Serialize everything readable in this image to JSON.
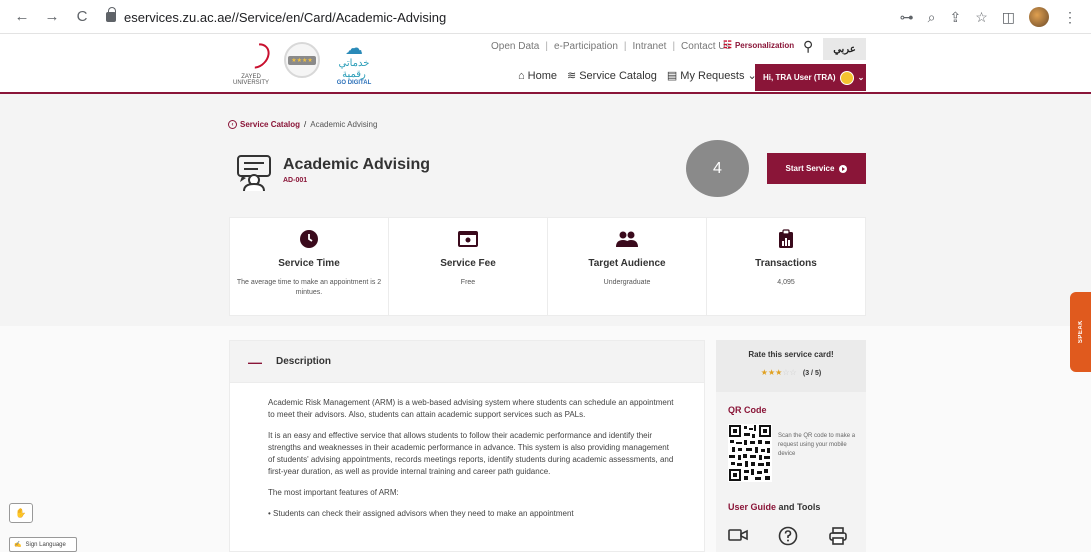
{
  "browser": {
    "nav_back": "←",
    "nav_forward": "→",
    "nav_reload": "C",
    "url": "eservices.zu.ac.ae//Service/en/Card/Academic-Advising"
  },
  "header": {
    "top_links": [
      "Open Data",
      "e-Participation",
      "Intranet",
      "Contact Us"
    ],
    "personalization": "Personalization",
    "arabic": "عربي",
    "nav": [
      {
        "icon": "home-icon",
        "label": "Home"
      },
      {
        "icon": "catalog-icon",
        "label": "Service Catalog"
      },
      {
        "icon": "requests-icon",
        "label": "My Requests"
      }
    ],
    "user": "Hi, TRA User (TRA)",
    "logo_zu_text": "ZAYED UNIVERSITY",
    "logo_gd_ar": "خدماتي رقمية",
    "logo_gd_en": "GO DIGITAL"
  },
  "breadcrumb": {
    "back": "Service Catalog",
    "separator": "/",
    "current": "Academic Advising"
  },
  "service": {
    "title": "Academic Advising",
    "code": "AD-001",
    "start_label": "Start Service"
  },
  "overlay_badge": "4",
  "stats": [
    {
      "icon": "clock-icon",
      "label": "Service Time",
      "value": "The average time to make an appointment is 2 mintues."
    },
    {
      "icon": "money-icon",
      "label": "Service Fee",
      "value": "Free"
    },
    {
      "icon": "users-icon",
      "label": "Target Audience",
      "value": "Undergraduate"
    },
    {
      "icon": "clipboard-chart-icon",
      "label": "Transactions",
      "value": "4,095"
    }
  ],
  "description": {
    "heading": "Description",
    "paragraphs": [
      "Academic Risk Management (ARM) is a web-based advising system where students can schedule an appointment to meet their advisors. Also, students can attain academic support services such as PALs.",
      "It is an easy and effective service that allows students to follow their academic performance and identify their strengths and weaknesses in their academic performance in advance. This system is also providing management of students' advising appointments, records meetings reports, identify students during academic assessments, and first-year duration, as well as provide internal training and career path guidance.",
      "The most important features of ARM:",
      "• Students can check their assigned advisors when they need to make an appointment"
    ]
  },
  "sidebar": {
    "rate_title": "Rate this service card!",
    "rating": 3,
    "rating_max": 5,
    "rating_text": "(3 / 5)",
    "qr_title": "QR Code",
    "qr_text": "Scan the QR code to make a request using your mobile device",
    "guide_title_a": "User Guide",
    "guide_title_b": "and Tools"
  },
  "speak_label": "SPEAK",
  "sign_language": "Sign Language",
  "colors": {
    "brand": "#8a1538",
    "speak": "#e05a1e",
    "star": "#e0a020"
  }
}
